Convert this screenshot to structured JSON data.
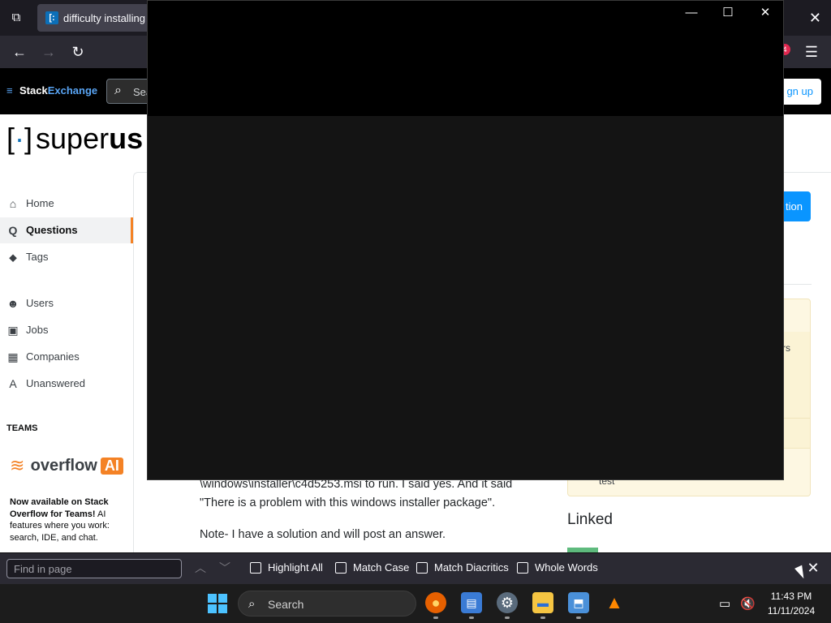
{
  "browser": {
    "tab_title": "difficulty installing r",
    "tab_favicon_glyph": "[·]"
  },
  "se_bar": {
    "logo_stack": "Stack",
    "logo_exchange": "Exchange",
    "search_placeholder": "Sea",
    "signup_label": "gn up"
  },
  "site": {
    "logo_text": "super",
    "logo_bold": "us"
  },
  "sidebar": {
    "items": [
      {
        "label": "Home",
        "icon": "⌂"
      },
      {
        "label": "Questions",
        "icon": "Q"
      },
      {
        "label": "Tags",
        "icon": "⬥"
      },
      {
        "label": "Users",
        "icon": "☻"
      },
      {
        "label": "Jobs",
        "icon": "▣"
      },
      {
        "label": "Companies",
        "icon": "▦"
      },
      {
        "label": "Unanswered",
        "icon": "A"
      }
    ],
    "teams_label": "TEAMS",
    "overflow_ai_text": "overflow",
    "overflow_ai_badge": "AI",
    "oai_bold": "Now available on Stack Overflow for Teams!",
    "oai_rest": " AI features where you work: search, IDE, and chat."
  },
  "main": {
    "ask_button_label": "tion",
    "widget_frag1": "rs",
    "widget_frag2": "t",
    "widget_frag3": "test",
    "question_line1": "\\windows\\installer\\c4d5253.msi to run. I said yes. And it said",
    "question_line2": "\"There is a problem with this windows installer package\".",
    "question_line3": "Note- I have a solution and will post an answer.",
    "linked_heading": "Linked"
  },
  "findbar": {
    "placeholder": "Find in page",
    "options": [
      "Highlight All",
      "Match Case",
      "Match Diacritics",
      "Whole Words"
    ]
  },
  "taskbar": {
    "search_label": "Search",
    "time": "11:43 PM",
    "date": "11/11/2024"
  },
  "colors": {
    "accent": "#f48225",
    "link": "#0a95ff",
    "taskbar": "#1c1c1c"
  }
}
